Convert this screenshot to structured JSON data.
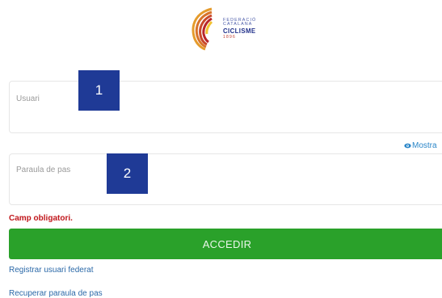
{
  "logo": {
    "line1": "FEDERACIÓ",
    "line2": "CATALANA",
    "line3": "CICLISME",
    "line4": "1896"
  },
  "form": {
    "user_label": "Usuari",
    "user_value": "",
    "password_label": "Paraula de pas",
    "password_value": "",
    "show_password_label": "Mostra",
    "error_text": "Camp obligatori.",
    "submit_label": "ACCEDIR"
  },
  "markers": [
    "1",
    "2"
  ],
  "links": {
    "register": "Registrar usuari federat",
    "recover": "Recuperar paraula de pas"
  },
  "colors": {
    "submit_bg": "#2aa12a",
    "error": "#c0161b",
    "link": "#2b69a8",
    "marker_bg": "#1f3a96"
  },
  "icons": {
    "logo": "fcc-logo-icon",
    "show_password": "eye-icon"
  }
}
